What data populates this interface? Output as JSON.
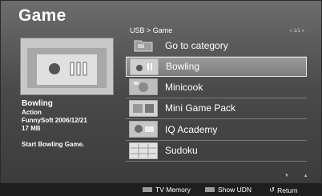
{
  "screen": {
    "title": "Game"
  },
  "preview": {
    "name": "Bowling",
    "genre": "Action",
    "maker_date": "FunnySoft 2006/12/21",
    "size": "17 MB",
    "description": "Start Bowling Game."
  },
  "browser": {
    "breadcrumb": "USB > Game",
    "page_indicator": "« 1/1 »",
    "items": [
      {
        "label": "Go to category",
        "icon": "folder-icon"
      },
      {
        "label": "Bowling",
        "icon": "bowling-thumb",
        "selected": true
      },
      {
        "label": "Minicook",
        "icon": "minicook-thumb"
      },
      {
        "label": "Mini Game Pack",
        "icon": "minigame-thumb"
      },
      {
        "label": "IQ Academy",
        "icon": "iqacademy-thumb"
      },
      {
        "label": "Sudoku",
        "icon": "sudoku-thumb"
      }
    ],
    "scroll_arrows": "▼ ▲"
  },
  "footer": {
    "tv_memory": "TV Memory",
    "show_udn": "Show UDN",
    "return_icon": "↺",
    "return": "Return"
  }
}
